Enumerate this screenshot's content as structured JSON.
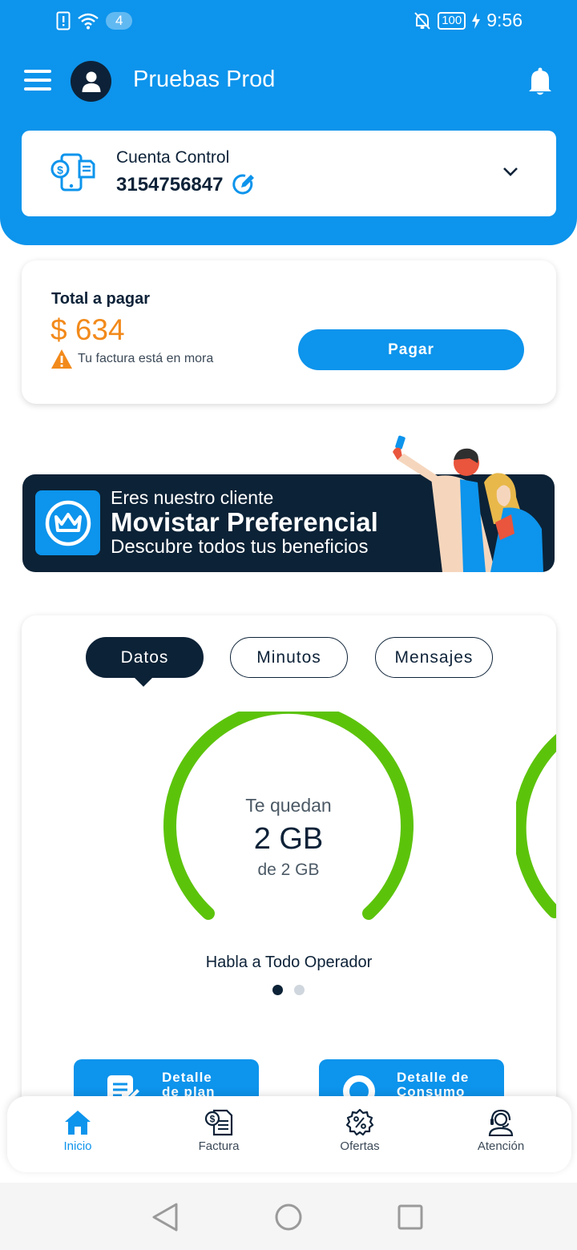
{
  "status_bar": {
    "notifications_badge": "4",
    "battery": "100",
    "time": "9:56"
  },
  "header": {
    "title": "Pruebas Prod"
  },
  "account": {
    "type": "Cuenta Control",
    "number": "3154756847"
  },
  "payment": {
    "label": "Total a pagar",
    "amount": "$ 634",
    "warning": "Tu factura está en mora",
    "pay_button": "Pagar"
  },
  "banner": {
    "line1": "Eres nuestro cliente",
    "line2": "Movistar Preferencial",
    "line3": "Descubre todos tus beneficios"
  },
  "usage": {
    "tabs": [
      {
        "label": "Datos",
        "active": true
      },
      {
        "label": "Minutos",
        "active": false
      },
      {
        "label": "Mensajes",
        "active": false
      }
    ],
    "gauge": {
      "top_label": "Te quedan",
      "value": "2 GB",
      "sub_label": "de 2 GB",
      "remaining_fraction": 1.0,
      "color": "#5cc30b"
    },
    "plan_name": "Habla a Todo Operador",
    "buttons": [
      {
        "label_line1": "Detalle",
        "label_line2": "de plan"
      },
      {
        "label_line1": "Detalle de",
        "label_line2": "Consumo"
      }
    ]
  },
  "bottom_nav": [
    {
      "label": "Inicio",
      "icon": "home-icon",
      "active": true
    },
    {
      "label": "Factura",
      "icon": "invoice-icon",
      "active": false
    },
    {
      "label": "Ofertas",
      "icon": "offers-icon",
      "active": false
    },
    {
      "label": "Atención",
      "icon": "support-icon",
      "active": false
    }
  ],
  "colors": {
    "primary": "#0d94ec",
    "dark": "#0c2236",
    "warning": "#f28a1b",
    "gauge": "#5cc30b"
  }
}
